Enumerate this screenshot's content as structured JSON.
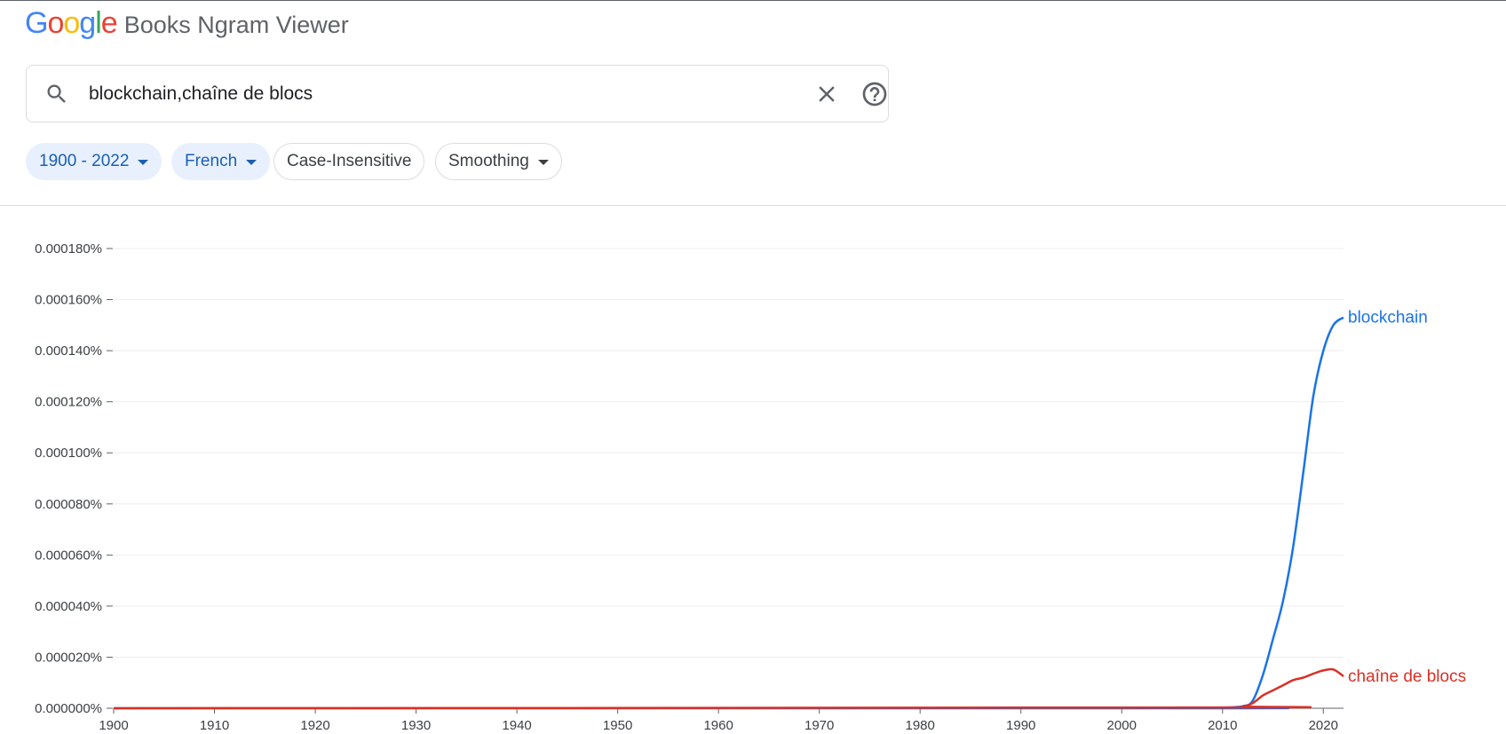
{
  "header": {
    "logo_letters": [
      {
        "ch": "G",
        "color": "#4285f4"
      },
      {
        "ch": "o",
        "color": "#ea4335"
      },
      {
        "ch": "o",
        "color": "#fbbc05"
      },
      {
        "ch": "g",
        "color": "#4285f4"
      },
      {
        "ch": "l",
        "color": "#34a853"
      },
      {
        "ch": "e",
        "color": "#ea4335"
      }
    ],
    "product": "Books Ngram Viewer"
  },
  "search": {
    "query": "blockchain,chaîne de blocs",
    "icons": {
      "search": "search-icon",
      "clear": "close-icon",
      "help": "help-circle-icon"
    }
  },
  "filters": {
    "range": "1900 - 2022",
    "corpus": "French",
    "case": "Case-Insensitive",
    "smoothing": "Smoothing"
  },
  "chart_data": {
    "type": "line",
    "xlim": [
      1900,
      2022
    ],
    "ylim": [
      0,
      0.00018
    ],
    "x_ticks": [
      1900,
      1910,
      1920,
      1930,
      1940,
      1950,
      1960,
      1970,
      1980,
      1990,
      2000,
      2010,
      2020
    ],
    "y_ticks": [
      0,
      2e-05,
      4e-05,
      6e-05,
      8e-05,
      0.0001,
      0.00012,
      0.00014,
      0.00016,
      0.00018
    ],
    "y_tick_labels": [
      "0.000000%",
      "0.000020%",
      "0.000040%",
      "0.000060%",
      "0.000080%",
      "0.000100%",
      "0.000120%",
      "0.000140%",
      "0.000160%",
      "0.000180%"
    ],
    "grid": true,
    "series": [
      {
        "name": "blockchain",
        "color": "#1a73e8",
        "points": [
          [
            1900,
            0
          ],
          [
            2008,
            0
          ],
          [
            2010,
            2e-07
          ],
          [
            2012,
            8e-07
          ],
          [
            2013,
            3e-06
          ],
          [
            2014,
            1.3e-05
          ],
          [
            2015,
            2.7e-05
          ],
          [
            2016,
            4.2e-05
          ],
          [
            2017,
            6.3e-05
          ],
          [
            2018,
            9.2e-05
          ],
          [
            2019,
            0.000122
          ],
          [
            2020,
            0.00014
          ],
          [
            2021,
            0.00015
          ],
          [
            2022,
            0.000153
          ]
        ]
      },
      {
        "name": "chaîne de blocs",
        "color": "#d93025",
        "points": [
          [
            1900,
            0
          ],
          [
            2010,
            3e-07
          ],
          [
            2012,
            7e-07
          ],
          [
            2013,
            2e-06
          ],
          [
            2014,
            5e-06
          ],
          [
            2015,
            7e-06
          ],
          [
            2016,
            9e-06
          ],
          [
            2017,
            1.1e-05
          ],
          [
            2018,
            1.2e-05
          ],
          [
            2019,
            1.35e-05
          ],
          [
            2020,
            1.48e-05
          ],
          [
            2021,
            1.52e-05
          ],
          [
            2022,
            1.25e-05
          ]
        ]
      }
    ]
  }
}
